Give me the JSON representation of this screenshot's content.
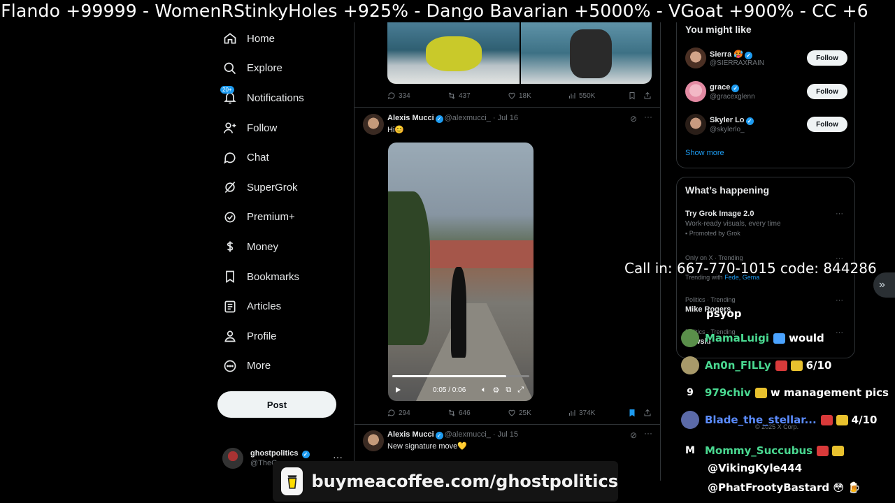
{
  "ticker": {
    "text": "-Flando +99999  -  WomenRStinkyHoles +925%  -  Dango Bavarian +5000%  -  VGoat +900%  -  CC +6"
  },
  "nav": {
    "items": [
      {
        "label": "Home",
        "icon": "home-icon"
      },
      {
        "label": "Explore",
        "icon": "search-icon"
      },
      {
        "label": "Notifications",
        "icon": "bell-icon",
        "badge": "20+"
      },
      {
        "label": "Follow",
        "icon": "person-add-icon"
      },
      {
        "label": "Chat",
        "icon": "chat-icon"
      },
      {
        "label": "SuperGrok",
        "icon": "grok-icon"
      },
      {
        "label": "Premium+",
        "icon": "premium-icon"
      },
      {
        "label": "Money",
        "icon": "money-icon"
      },
      {
        "label": "Bookmarks",
        "icon": "bookmark-icon"
      },
      {
        "label": "Articles",
        "icon": "articles-icon"
      },
      {
        "label": "Profile",
        "icon": "profile-icon"
      },
      {
        "label": "More",
        "icon": "more-icon"
      }
    ],
    "post_label": "Post"
  },
  "account": {
    "name": "ghostpolitics",
    "handle": "@TheG"
  },
  "feed": {
    "top_post_stats": {
      "replies": "334",
      "reposts": "437",
      "likes": "18K",
      "views": "550K"
    },
    "tweet1": {
      "name": "Alexis Mucci",
      "handle": "@alexmucci_ · Jul 16",
      "text": "Hi😊",
      "video_time": "0:05 / 0:06",
      "video_progress": 0.83,
      "stats": {
        "replies": "294",
        "reposts": "646",
        "likes": "25K",
        "views": "374K"
      }
    },
    "tweet2": {
      "name": "Alexis Mucci",
      "handle": "@alexmucci_ · Jul 15",
      "text": "New signature move💛"
    }
  },
  "sidebar": {
    "might_like": {
      "title": "You might like",
      "users": [
        {
          "name": "Sierra 🥵",
          "handle": "@SIERRAXRAIN",
          "follow": "Follow"
        },
        {
          "name": "grace",
          "handle": "@gracexglenn",
          "follow": "Follow"
        },
        {
          "name": "Skyler Lo",
          "handle": "@skylerlo_",
          "follow": "Follow"
        }
      ],
      "show_more": "Show more"
    },
    "happening": {
      "title": "What’s happening",
      "trends": [
        {
          "title": "Try Grok Image 2.0",
          "sub": "Work-ready visuals, every time",
          "promo": "Promoted by Grok"
        },
        {
          "context": "Only on X · Trending",
          "with_label": "Trending with",
          "with_links": "Fede, Gema"
        },
        {
          "context": "Politics · Trending",
          "title": "Mike Rogers"
        },
        {
          "context": "Politics · Trending",
          "title": "kowski"
        }
      ],
      "footer": "© 2025 X Corp."
    }
  },
  "overlay": {
    "callin": "Call in: 667-770-1015 code: 844286",
    "side_tab": "»",
    "chat": [
      {
        "user": "",
        "msg": "psyop"
      },
      {
        "user": "MamaLuigi",
        "msg": "would"
      },
      {
        "user": "An0n_FILLy",
        "msg": "6/10"
      },
      {
        "letter": "9",
        "user": "979chiv",
        "msg": "w management pics"
      },
      {
        "user": "Blade_the_stellar...",
        "msg": "4/10"
      },
      {
        "letter": "M",
        "user": "Mommy_Succubus",
        "msg": ""
      },
      {
        "user": "",
        "msg": "@VikingKyle444"
      },
      {
        "user": "",
        "msg": "@PhatFrootyBastard 😳 🍺"
      }
    ],
    "coffee": "buymeacoffee.com/ghostpolitics"
  }
}
